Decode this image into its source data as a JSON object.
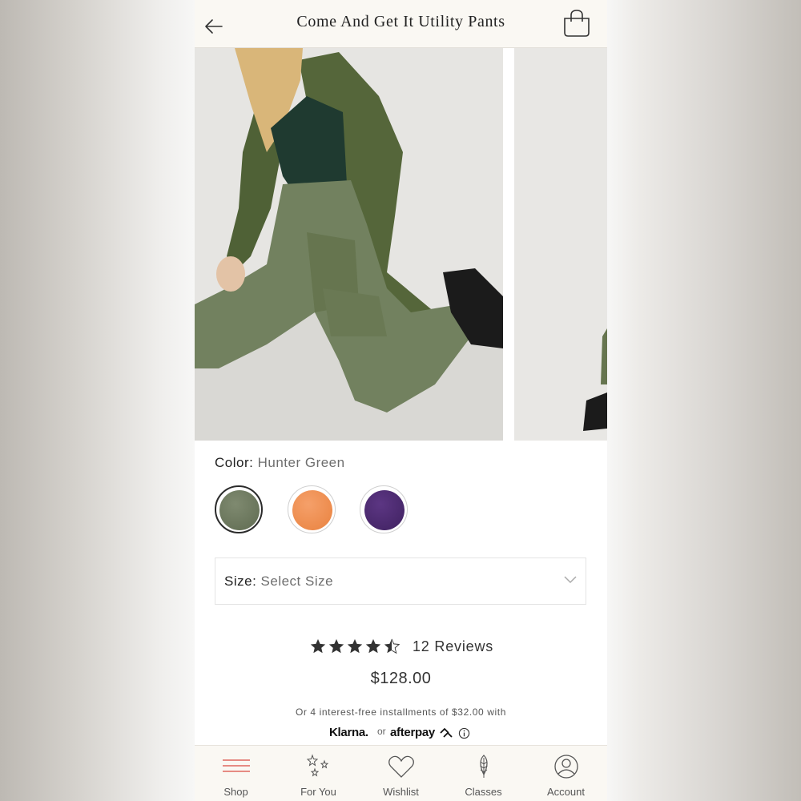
{
  "header": {
    "title": "Come And Get It Utility Pants",
    "back_icon": "arrow-left-icon",
    "bag_icon": "shopping-bag-icon"
  },
  "gallery": {
    "images": [
      "product-photo-model-kneeling",
      "product-photo-partial-next"
    ]
  },
  "color": {
    "label": "Color:",
    "selected": "Hunter Green",
    "swatches": [
      {
        "name": "Hunter Green",
        "hex": "#6f7a60",
        "selected": true
      },
      {
        "name": "Orange",
        "hex": "#f08f52",
        "selected": false
      },
      {
        "name": "Purple",
        "hex": "#4b2a6e",
        "selected": false
      }
    ]
  },
  "size": {
    "label": "Size:",
    "placeholder": "Select Size"
  },
  "rating": {
    "stars": 4.5,
    "reviews_text": "12 Reviews"
  },
  "price": "$128.00",
  "payment": {
    "installments_text": "Or 4 interest-free installments of $32.00 with",
    "klarna": "Klarna.",
    "or": "or",
    "afterpay": "afterpay"
  },
  "nav": {
    "items": [
      {
        "label": "Shop",
        "icon": "menu-lines-icon",
        "active": true
      },
      {
        "label": "For You",
        "icon": "sparkle-stars-icon",
        "active": false
      },
      {
        "label": "Wishlist",
        "icon": "heart-icon",
        "active": false
      },
      {
        "label": "Classes",
        "icon": "feather-icon",
        "active": false
      },
      {
        "label": "Account",
        "icon": "account-icon",
        "active": false
      }
    ],
    "active_color": "#e0675e"
  }
}
